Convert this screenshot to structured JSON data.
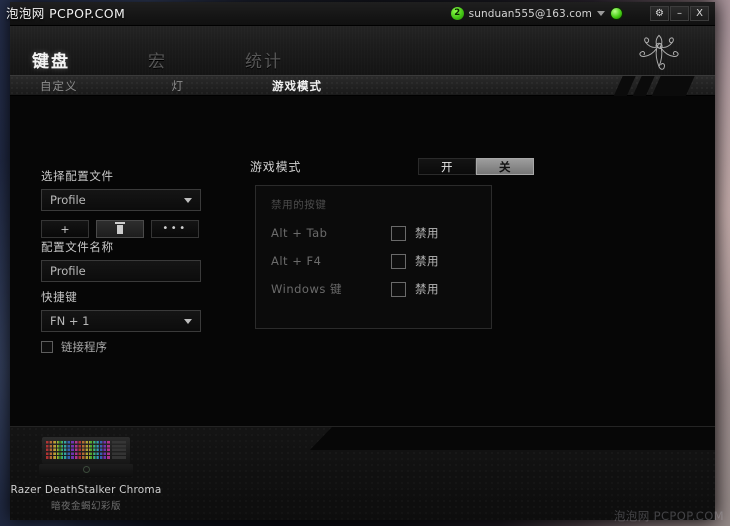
{
  "watermark": {
    "top": "泡泡网  PCPOP.COM",
    "bottom": "泡泡网 PCPOP.COM"
  },
  "titlebar": {
    "notification_count": "2",
    "account_email": "sunduan555@163.com",
    "dropdown_icon": "chevron-down-icon",
    "status_icon": "online-status-icon",
    "settings_label": "⚙",
    "minimize_label": "–",
    "close_label": "X"
  },
  "header": {
    "logo": "razer-triple-snake-logo",
    "main_tabs": [
      {
        "label": "键盘",
        "active": true
      },
      {
        "label": "宏",
        "active": false
      },
      {
        "label": "统计",
        "active": false
      }
    ],
    "sub_tabs": [
      {
        "label": "自定义",
        "active": false
      },
      {
        "label": "灯",
        "active": false
      },
      {
        "label": "游戏模式",
        "active": true
      }
    ]
  },
  "profile": {
    "select_label": "选择配置文件",
    "selected_profile": "Profile",
    "add_button": "+",
    "delete_button": "delete-icon",
    "more_button": "•••",
    "name_label": "配置文件名称",
    "name_value": "Profile",
    "shortcut_label": "快捷键",
    "shortcut_value": "FN + 1",
    "link_program_label": "链接程序",
    "link_program_checked": false
  },
  "game_mode": {
    "label": "游戏模式",
    "on_label": "开",
    "off_label": "关",
    "selected": "off",
    "panel_title": "禁用的按键",
    "disabled_keys": [
      {
        "key": "Alt + Tab",
        "checkbox_label": "禁用",
        "checked": false
      },
      {
        "key": "Alt + F4",
        "checkbox_label": "禁用",
        "checked": false
      },
      {
        "key": "Windows 键",
        "checkbox_label": "禁用",
        "checked": false
      }
    ]
  },
  "device": {
    "name": "Razer DeathStalker Chroma",
    "name_cn": "暗夜金蝎幻彩版",
    "thumbnail": "razer-keyboard-thumbnail"
  },
  "colors": {
    "accent_green": "#46cf14",
    "panel_bg": "#0b0b0b",
    "text_primary": "#e6e6e6",
    "text_dim": "#6b6b6b"
  }
}
